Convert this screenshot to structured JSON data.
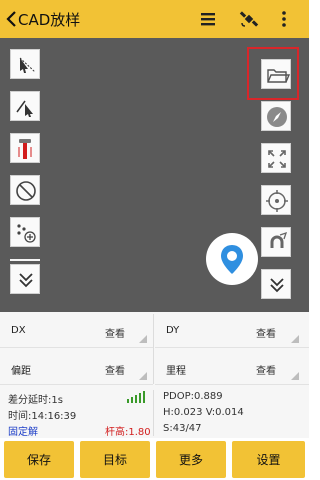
{
  "header": {
    "title": "CAD放样",
    "back_icon": "chevron-left-icon",
    "menu_icon": "list-icon",
    "satellite_icon": "satellite-icon",
    "more_icon": "more-vertical-icon"
  },
  "map": {
    "left_tools": [
      "select-arrow-icon",
      "line-select-icon",
      "pole-icon",
      "no-snap-icon",
      "add-point-icon",
      "expand-down-icon"
    ],
    "right_tools": [
      "folder-icon",
      "compass-icon",
      "full-extent-icon",
      "crosshair-icon",
      "magnet-icon",
      "expand-down-icon"
    ],
    "pin_icon": "location-pin-icon"
  },
  "info": {
    "dx_label": "DX",
    "dx_view": "查看",
    "dy_label": "DY",
    "dy_view": "查看",
    "offset_label": "偏距",
    "offset_view": "查看",
    "mileage_label": "里程",
    "mileage_view": "查看"
  },
  "status": {
    "diff_delay": "差分延时:1s",
    "pdop": "PDOP:0.889",
    "time": "时间:14:16:39",
    "hv": "H:0.023  V:0.014",
    "fix": "固定解",
    "pole_height": "杆高:1.80",
    "satellites": "S:43/47",
    "signal_icon": "signal-bars-icon"
  },
  "colors": {
    "accent": "#f2c235",
    "map_bg": "#5a5a5a",
    "highlight": "#d8262a",
    "fix_blue": "#1e3fc8",
    "pole_red": "#d21d1d",
    "signal_green": "#3a9a2a"
  },
  "buttons": {
    "save": "保存",
    "target": "目标",
    "more": "更多",
    "settings": "设置"
  }
}
